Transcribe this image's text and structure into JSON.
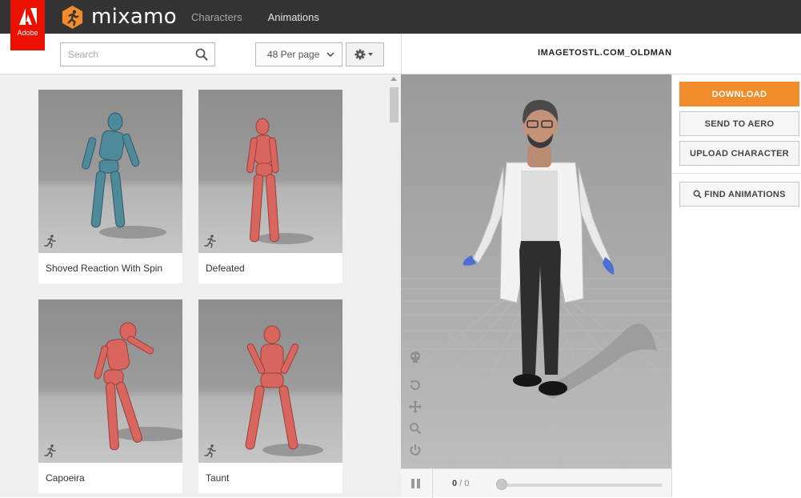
{
  "brand": {
    "adobe_word": "Adobe",
    "name": "mixamo"
  },
  "nav": [
    {
      "label": "Characters",
      "active": false
    },
    {
      "label": "Animations",
      "active": true
    }
  ],
  "toolbar": {
    "search_placeholder": "Search",
    "per_page": "48 Per page"
  },
  "animations": [
    {
      "label": "Shoved Reaction With Spin",
      "color": "#4f8a9a"
    },
    {
      "label": "Defeated",
      "color": "#d8655e"
    },
    {
      "label": "Capoeira",
      "color": "#d8655e"
    },
    {
      "label": "Taunt",
      "color": "#d8655e"
    }
  ],
  "viewer": {
    "title": "IMAGETOSTL.COM_OLDMAN",
    "frame_current": "0",
    "frame_separator": " / ",
    "frame_total": "0",
    "timeline_progress": 0
  },
  "actions": {
    "download": "DOWNLOAD",
    "send_to_aero": "SEND TO AERO",
    "upload_character": "UPLOAD CHARACTER",
    "find_animations": "FIND ANIMATIONS"
  },
  "colors": {
    "accent": "#f28b2b",
    "adobe_red": "#eb1000",
    "topbar": "#333333"
  }
}
